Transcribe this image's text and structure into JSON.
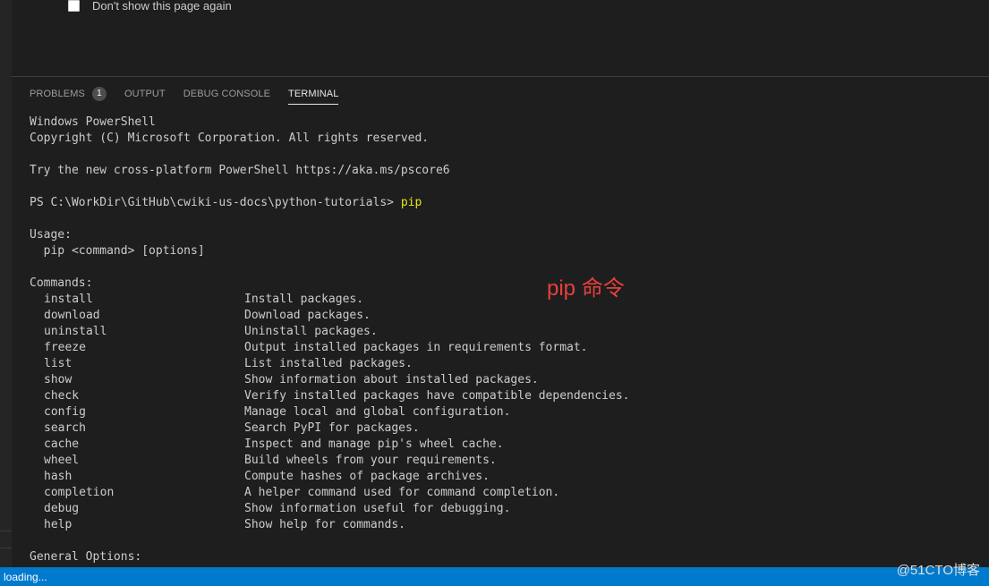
{
  "welcome": {
    "dont_show_label": "Don't show this page again"
  },
  "panel": {
    "tabs": [
      {
        "label": "PROBLEMS",
        "badge": "1",
        "active": false
      },
      {
        "label": "OUTPUT",
        "active": false
      },
      {
        "label": "DEBUG CONSOLE",
        "active": false
      },
      {
        "label": "TERMINAL",
        "active": true
      }
    ]
  },
  "terminal": {
    "header": [
      "Windows PowerShell",
      "Copyright (C) Microsoft Corporation. All rights reserved.",
      "",
      "Try the new cross-platform PowerShell https://aka.ms/pscore6",
      ""
    ],
    "prompt": "PS C:\\WorkDir\\GitHub\\cwiki-us-docs\\python-tutorials> ",
    "command": "pip",
    "usage_title": "Usage:",
    "usage_line": "  pip <command> [options]",
    "commands_title": "Commands:",
    "commands": [
      {
        "name": "install",
        "desc": "Install packages."
      },
      {
        "name": "download",
        "desc": "Download packages."
      },
      {
        "name": "uninstall",
        "desc": "Uninstall packages."
      },
      {
        "name": "freeze",
        "desc": "Output installed packages in requirements format."
      },
      {
        "name": "list",
        "desc": "List installed packages."
      },
      {
        "name": "show",
        "desc": "Show information about installed packages."
      },
      {
        "name": "check",
        "desc": "Verify installed packages have compatible dependencies."
      },
      {
        "name": "config",
        "desc": "Manage local and global configuration."
      },
      {
        "name": "search",
        "desc": "Search PyPI for packages."
      },
      {
        "name": "cache",
        "desc": "Inspect and manage pip's wheel cache."
      },
      {
        "name": "wheel",
        "desc": "Build wheels from your requirements."
      },
      {
        "name": "hash",
        "desc": "Compute hashes of package archives."
      },
      {
        "name": "completion",
        "desc": "A helper command used for command completion."
      },
      {
        "name": "debug",
        "desc": "Show information useful for debugging."
      },
      {
        "name": "help",
        "desc": "Show help for commands."
      }
    ],
    "general_options_title": "General Options:"
  },
  "annotation": "pip 命令",
  "status": {
    "text": "loading..."
  },
  "watermark": "@51CTO博客",
  "colors": {
    "background": "#1e1e1e",
    "status_bar": "#007acc",
    "highlight": "#e5e510",
    "annotation": "#e8403c"
  }
}
